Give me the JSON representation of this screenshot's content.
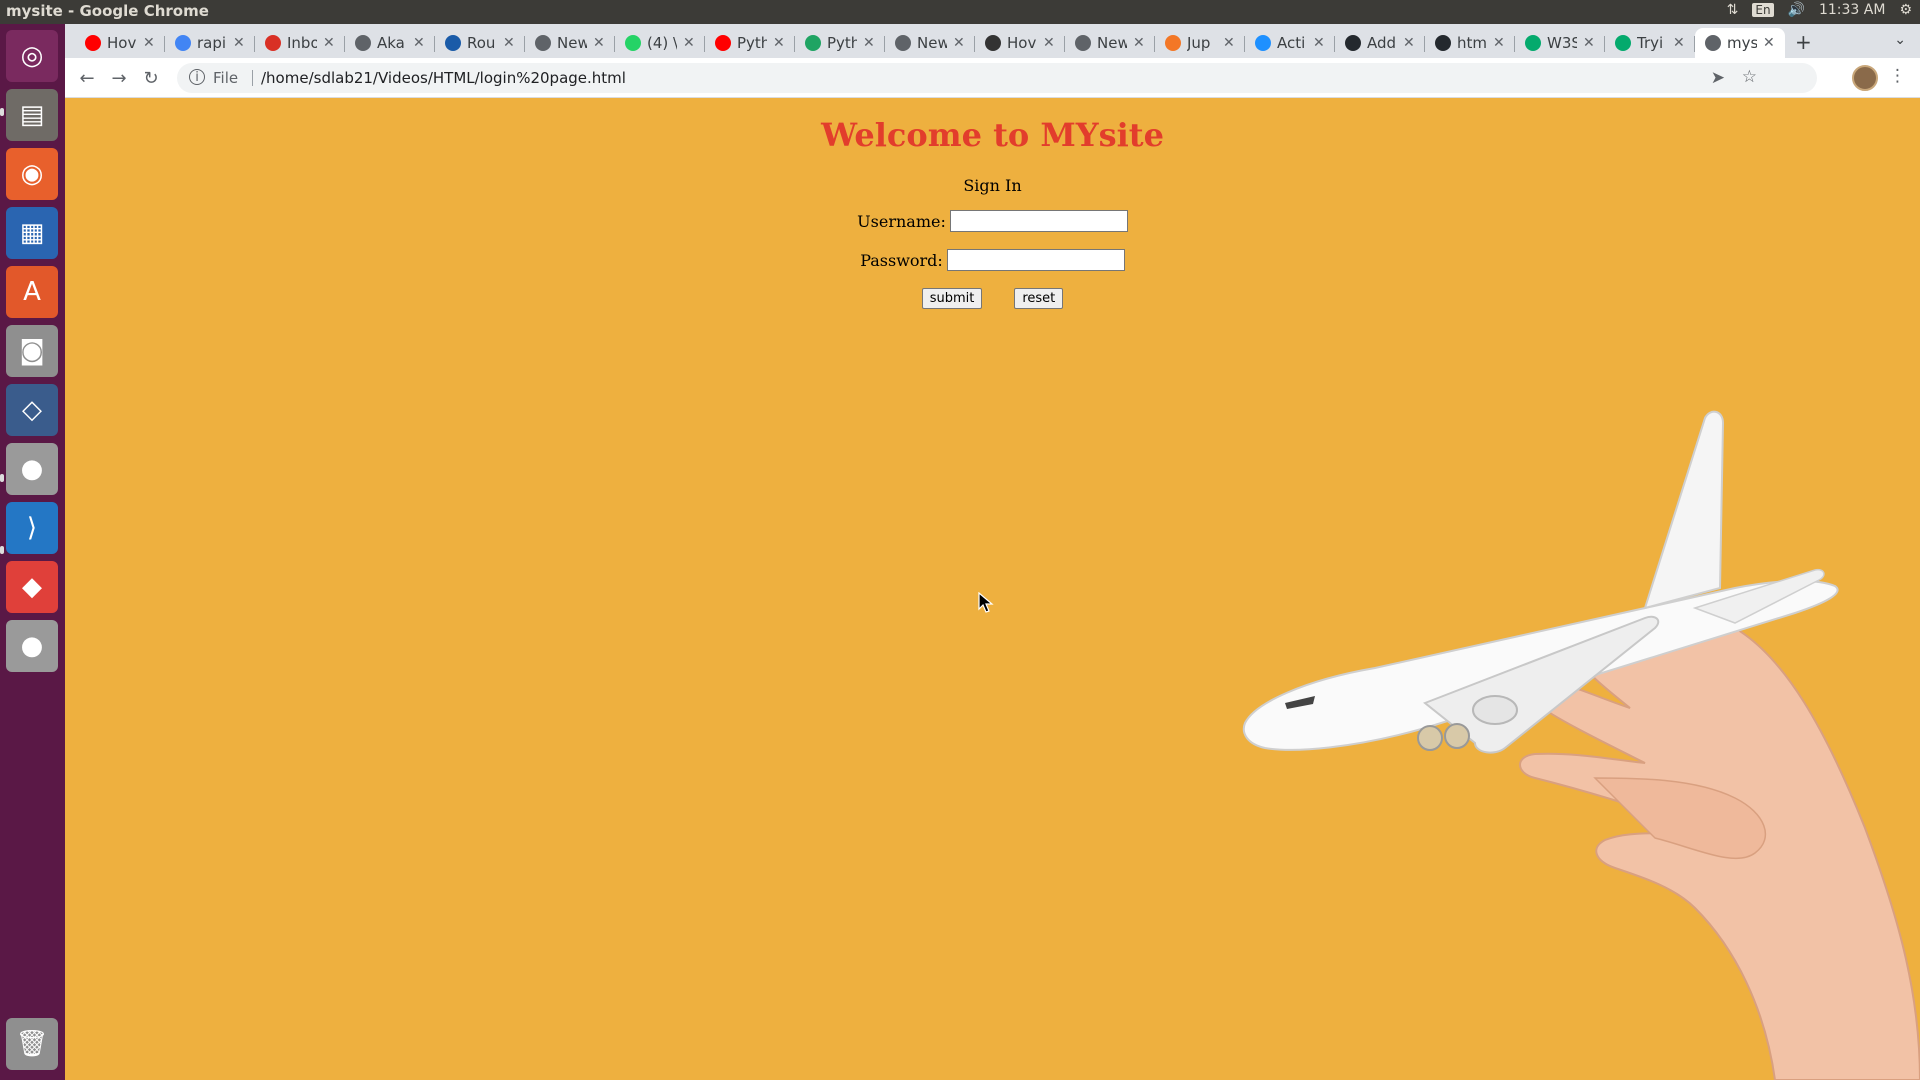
{
  "os": {
    "window_title": "mysite - Google Chrome",
    "clock": "11:33 AM",
    "keyboard_indicator": "En",
    "launcher": [
      {
        "name": "ubuntu-dash-icon",
        "color": "#7a2a5f"
      },
      {
        "name": "files-icon",
        "color": "#6f6b66"
      },
      {
        "name": "firefox-icon",
        "color": "#e8602c"
      },
      {
        "name": "libreoffice-writer-icon",
        "color": "#2a65b1"
      },
      {
        "name": "software-center-icon",
        "color": "#e2582a"
      },
      {
        "name": "screenshot-icon",
        "color": "#8f8f8f"
      },
      {
        "name": "virtualbox-icon",
        "color": "#3a5c8c"
      },
      {
        "name": "chrome-icon",
        "color": "#9a9a9a"
      },
      {
        "name": "vscode-icon",
        "color": "#2477c5"
      },
      {
        "name": "git-icon",
        "color": "#e0403a"
      },
      {
        "name": "chrome-icon-2",
        "color": "#9a9a9a"
      },
      {
        "name": "trash-icon",
        "color": "#8f8f8f"
      }
    ]
  },
  "browser": {
    "tabs": [
      {
        "label": "Hov",
        "icon": "youtube-icon",
        "color": "#ff0000"
      },
      {
        "label": "rapi",
        "icon": "google-icon",
        "color": "#4285f4"
      },
      {
        "label": "Inbo",
        "icon": "gmail-icon",
        "color": "#d93025"
      },
      {
        "label": "Aka",
        "icon": "globe-icon",
        "color": "#5f6368"
      },
      {
        "label": "Rou",
        "icon": "site-icon",
        "color": "#1a5ba8"
      },
      {
        "label": "New",
        "icon": "globe-icon",
        "color": "#5f6368"
      },
      {
        "label": "(4) \\",
        "icon": "whatsapp-icon",
        "color": "#25d366"
      },
      {
        "label": "Pyth",
        "icon": "youtube-icon",
        "color": "#ff0000"
      },
      {
        "label": "Pyth",
        "icon": "drive-icon",
        "color": "#1fa463"
      },
      {
        "label": "New",
        "icon": "globe-icon",
        "color": "#5f6368"
      },
      {
        "label": "Hov",
        "icon": "site-icon",
        "color": "#333333"
      },
      {
        "label": "New",
        "icon": "globe-icon",
        "color": "#5f6368"
      },
      {
        "label": "Jup",
        "icon": "jupyter-icon",
        "color": "#f37726"
      },
      {
        "label": "Acti",
        "icon": "site-icon",
        "color": "#1e90ff"
      },
      {
        "label": "Add",
        "icon": "github-icon",
        "color": "#24292e"
      },
      {
        "label": "htm",
        "icon": "github-icon",
        "color": "#24292e"
      },
      {
        "label": "W3S",
        "icon": "w3schools-icon",
        "color": "#04aa6d"
      },
      {
        "label": "Tryi",
        "icon": "w3schools-icon",
        "color": "#04aa6d"
      },
      {
        "label": "mys",
        "icon": "globe-icon",
        "color": "#5f6368",
        "active": true
      }
    ],
    "address": {
      "scheme": "File",
      "url": "/home/sdlab21/Videos/HTML/login%20page.html"
    }
  },
  "page": {
    "heading": "Welcome to MYsite",
    "subheading": "Sign In",
    "username_label": "Username:",
    "username_value": "",
    "password_label": "Password:",
    "password_value": "",
    "submit_label": "submit",
    "reset_label": "reset",
    "background_color": "#eeb03f",
    "heading_color": "#e23d2c"
  }
}
